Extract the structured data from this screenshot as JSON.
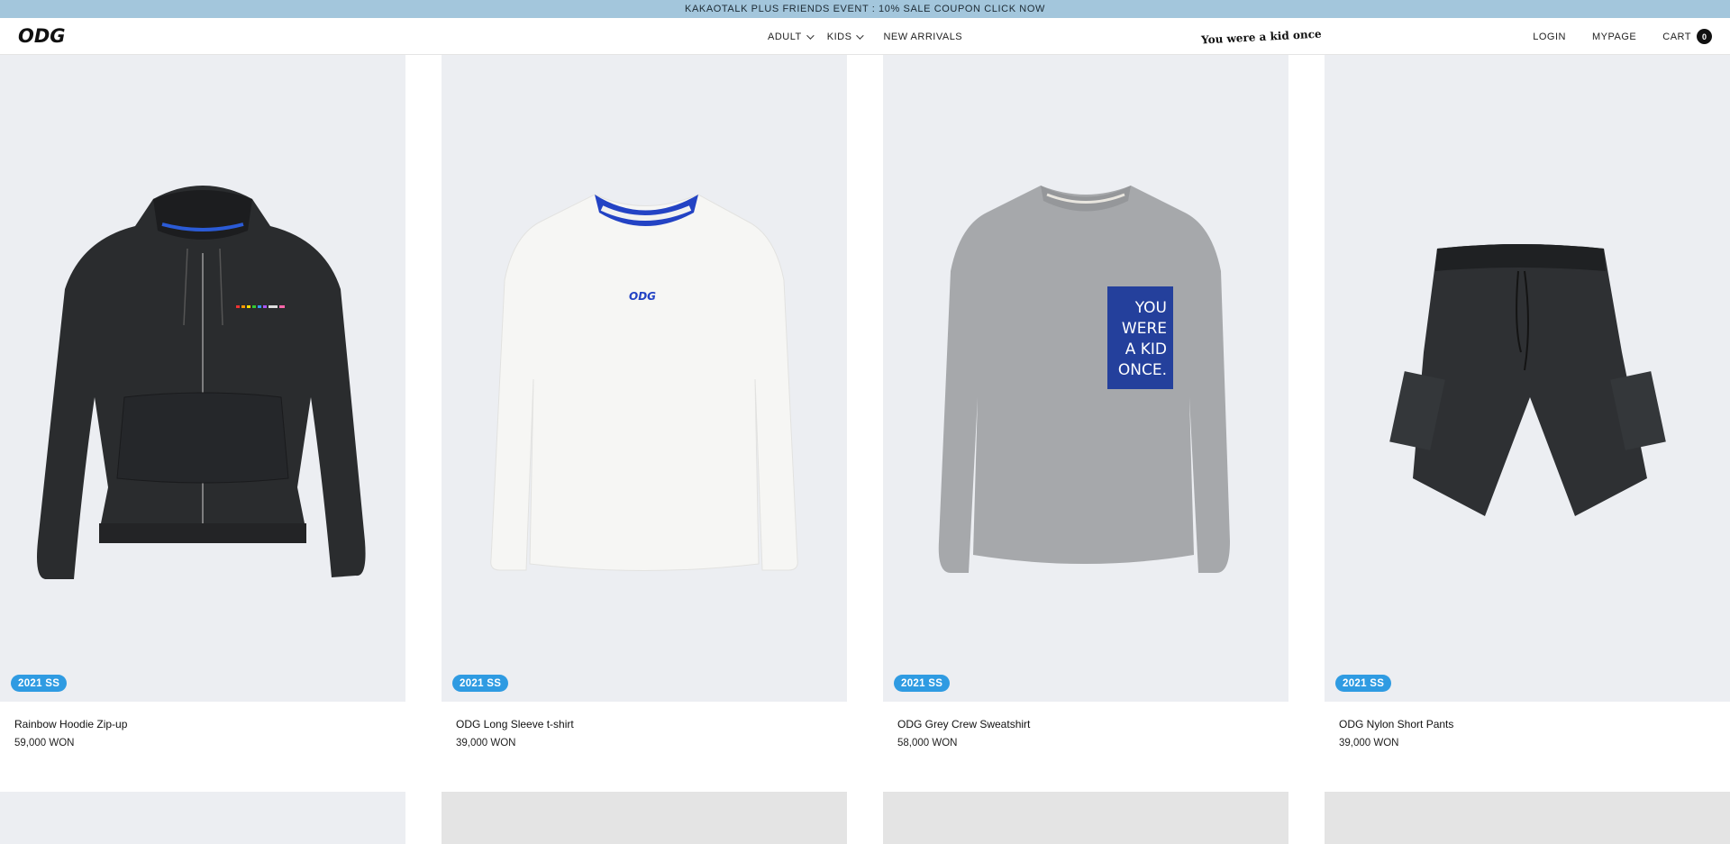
{
  "announcement": "KAKAOTALK PLUS FRIENDS EVENT : 10% SALE COUPON CLICK NOW",
  "header": {
    "logo": "ODG",
    "nav": [
      {
        "label": "ADULT",
        "dropdown": true
      },
      {
        "label": "KIDS",
        "dropdown": true
      },
      {
        "label": "NEW ARRIVALS",
        "dropdown": false
      }
    ],
    "tagline": "You were a kid once",
    "login": "LOGIN",
    "mypage": "MYPAGE",
    "cart": "CART",
    "cart_count": "0"
  },
  "products": [
    {
      "badge": "2021 SS",
      "name": "Rainbow Hoodie Zip-up",
      "price": "59,000 WON",
      "graphic_icon": "black-zip-hoodie"
    },
    {
      "badge": "2021 SS",
      "name": "ODG Long Sleeve t-shirt",
      "price": "39,000 WON",
      "graphic_icon": "white-long-sleeve-tee",
      "print": "ODG"
    },
    {
      "badge": "2021 SS",
      "name": "ODG Grey Crew Sweatshirt",
      "price": "58,000 WON",
      "graphic_icon": "grey-sweatshirt",
      "print": [
        "YOU",
        "WERE",
        "A KID",
        "ONCE."
      ]
    },
    {
      "badge": "2021 SS",
      "name": "ODG Nylon Short Pants",
      "price": "39,000 WON",
      "graphic_icon": "black-nylon-shorts"
    }
  ],
  "colors": {
    "announcement_bg": "#a3c6dc",
    "badge_bg": "#2f9be2",
    "photo_bg": "#eceef2",
    "photo_bg_alt": "#e4e4e4"
  }
}
